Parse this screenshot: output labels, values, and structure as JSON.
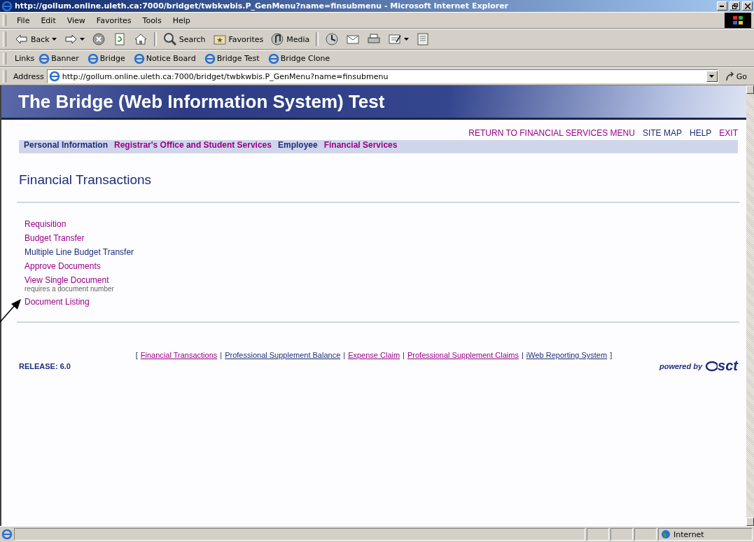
{
  "window": {
    "title": "http://gollum.online.uleth.ca:7000/bridget/twbkwbis.P_GenMenu?name=finsubmenu - Microsoft Internet Explorer"
  },
  "menu": [
    "File",
    "Edit",
    "View",
    "Favorites",
    "Tools",
    "Help"
  ],
  "toolbar": [
    {
      "kind": "back",
      "label": "Back"
    },
    {
      "kind": "forward"
    },
    {
      "kind": "stop"
    },
    {
      "kind": "refresh"
    },
    {
      "kind": "home"
    },
    {
      "kind": "search",
      "label": "Search"
    },
    {
      "kind": "favorites",
      "label": "Favorites"
    },
    {
      "kind": "media",
      "label": "Media"
    },
    {
      "kind": "history"
    },
    {
      "kind": "mail"
    },
    {
      "kind": "print"
    },
    {
      "kind": "edit"
    },
    {
      "kind": "discuss"
    }
  ],
  "links_bar": {
    "label": "Links",
    "items": [
      "Banner",
      "Bridge",
      "Notice Board",
      "Bridge Test",
      "Bridge Clone"
    ]
  },
  "address_bar": {
    "label": "Address",
    "value": "http://gollum.online.uleth.ca:7000/bridget/twbkwbis.P_GenMenu?name=finsubmenu",
    "go": "Go"
  },
  "page": {
    "banner": "The Bridge (Web Information System) Test",
    "top_links": [
      {
        "label": "RETURN TO FINANCIAL SERVICES MENU",
        "visited": true
      },
      {
        "label": "SITE MAP",
        "visited": false
      },
      {
        "label": "HELP",
        "visited": false
      },
      {
        "label": "EXIT",
        "visited": true
      }
    ],
    "nav_tabs": [
      {
        "label": "Personal Information",
        "visited": false
      },
      {
        "label": "Registrar's Office and Student Services",
        "visited": true
      },
      {
        "label": "Employee",
        "visited": false
      },
      {
        "label": "Financial Services",
        "visited": true
      }
    ],
    "heading": "Financial Transactions",
    "menu_items": [
      {
        "label": "Requisition",
        "visited": true
      },
      {
        "label": "Budget Transfer",
        "visited": true
      },
      {
        "label": "Multiple Line Budget Transfer",
        "visited": false
      },
      {
        "label": "Approve Documents",
        "visited": true
      },
      {
        "label": "View Single Document",
        "visited": true,
        "note": "requires a document number"
      },
      {
        "label": "Document Listing",
        "visited": true
      }
    ],
    "footer_links": [
      {
        "kind": "bracket",
        "text": "["
      },
      {
        "kind": "link",
        "text": "Financial Transactions",
        "visited": true
      },
      {
        "kind": "separator",
        "text": "|"
      },
      {
        "kind": "link",
        "text": "Professional Supplement Balance",
        "visited": false
      },
      {
        "kind": "separator",
        "text": "|"
      },
      {
        "kind": "link",
        "text": "Expense Claim",
        "visited": true
      },
      {
        "kind": "separator",
        "text": "|"
      },
      {
        "kind": "link",
        "text": "Professional Supplement Claims",
        "visited": true
      },
      {
        "kind": "separator",
        "text": "|"
      },
      {
        "kind": "link",
        "text": "iWeb Reporting System",
        "visited": false
      },
      {
        "kind": "bracket",
        "text": "]"
      }
    ],
    "release": "RELEASE: 6.0",
    "powered_by": "powered by",
    "logo": "sct"
  },
  "status_bar": {
    "zone": "Internet"
  }
}
